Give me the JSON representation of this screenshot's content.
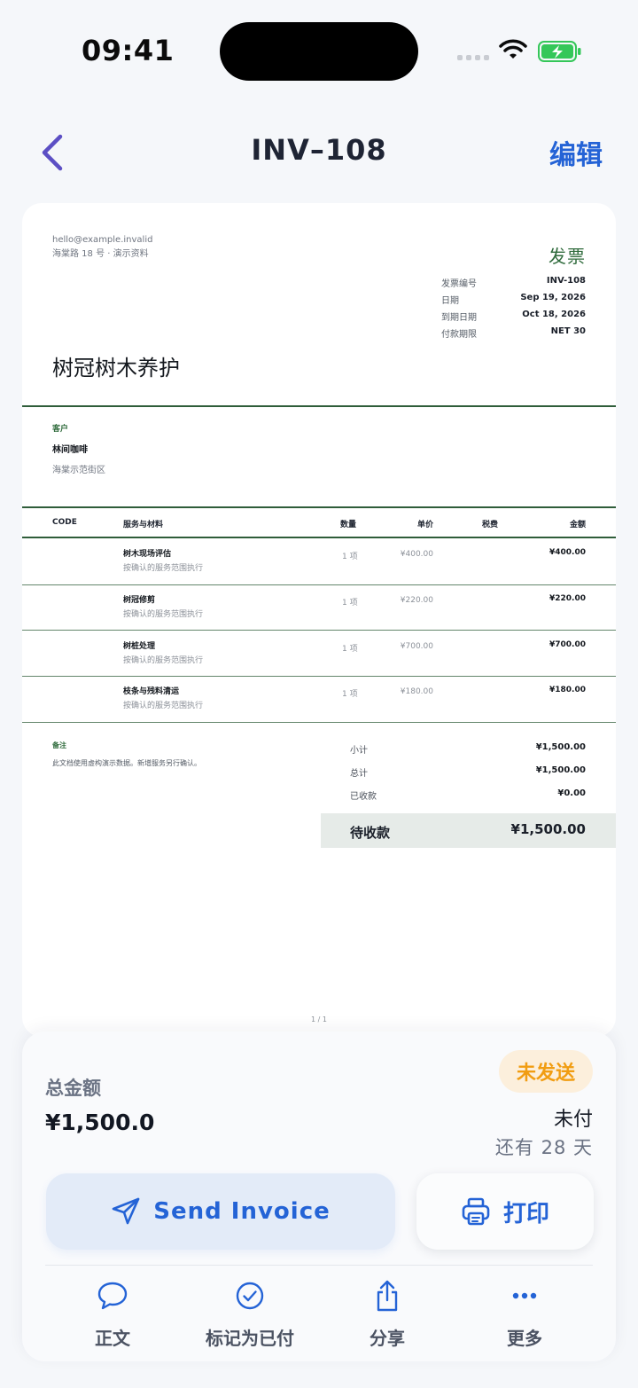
{
  "status_bar": {
    "time": "09:41"
  },
  "nav": {
    "title": "INV–108",
    "edit_label": "编辑"
  },
  "invoice": {
    "sender_email": "hello@example.invalid",
    "sender_address": "海棠路 18 号 · 演示资料",
    "doc_title": "发票",
    "meta": [
      {
        "label": "发票编号",
        "value": "INV-108"
      },
      {
        "label": "日期",
        "value": "Sep 19, 2026"
      },
      {
        "label": "到期日期",
        "value": "Oct 18, 2026"
      },
      {
        "label": "付款期限",
        "value": "NET 30"
      }
    ],
    "company_name": "树冠树木养护",
    "client_label": "客户",
    "client_name": "林间咖啡",
    "client_address": "海棠示范街区",
    "columns": {
      "code": "CODE",
      "service": "服务与材料",
      "qty": "数量",
      "unit_price": "单价",
      "tax": "税费",
      "amount": "金额"
    },
    "items": [
      {
        "name": "树木现场评估",
        "desc": "按确认的服务范围执行",
        "qty": "1 项",
        "unit_price": "¥400.00",
        "amount": "¥400.00"
      },
      {
        "name": "树冠修剪",
        "desc": "按确认的服务范围执行",
        "qty": "1 项",
        "unit_price": "¥220.00",
        "amount": "¥220.00"
      },
      {
        "name": "树桩处理",
        "desc": "按确认的服务范围执行",
        "qty": "1 项",
        "unit_price": "¥700.00",
        "amount": "¥700.00"
      },
      {
        "name": "枝条与残料清运",
        "desc": "按确认的服务范围执行",
        "qty": "1 项",
        "unit_price": "¥180.00",
        "amount": "¥180.00"
      }
    ],
    "notes_label": "备注",
    "notes_text": "此文档使用虚构演示数据。新增服务另行确认。",
    "summary": [
      {
        "label": "小计",
        "value": "¥1,500.00"
      },
      {
        "label": "总计",
        "value": "¥1,500.00"
      },
      {
        "label": "已收款",
        "value": "¥0.00"
      }
    ],
    "balance_due_label": "待收款",
    "balance_due_value": "¥1,500.00",
    "page_number": "1 / 1"
  },
  "sheet": {
    "total_label": "总金额",
    "total_value": "¥1,500.0",
    "status_badge": "未发送",
    "payment_status": "未付",
    "days_left": "还有 28 天",
    "send_label": "Send Invoice",
    "print_label": "打印",
    "tabs": [
      {
        "label": "正文",
        "icon": "chat-bubble-icon"
      },
      {
        "label": "标记为已付",
        "icon": "check-circle-icon"
      },
      {
        "label": "分享",
        "icon": "share-icon"
      },
      {
        "label": "更多",
        "icon": "more-icon"
      }
    ]
  },
  "colors": {
    "accent": "#2463d6",
    "invoice_green": "#2f6b3c",
    "badge_bg": "#fcefdc",
    "badge_text": "#f19d12"
  }
}
